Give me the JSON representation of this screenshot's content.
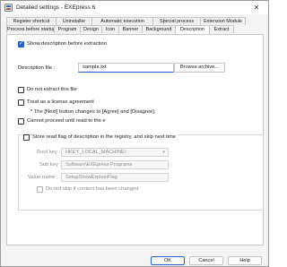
{
  "window": {
    "title": "Detailed settings - EXEpress 6",
    "close_glyph": "✕"
  },
  "tabs_row1": [
    "Register shortcut",
    "Uninstaller",
    "Automatic execution",
    "Special process",
    "Extension Module"
  ],
  "tabs_row2": [
    "Process before startup",
    "Program",
    "Design",
    "Icon",
    "Banner",
    "Background",
    "Description",
    "Extract"
  ],
  "active_tab": "Description",
  "description": {
    "show_before_extraction": {
      "label": "Show description before extraction",
      "checked": true
    },
    "file_label": "Description file :",
    "file_value": "sample.txt",
    "browse_label": "Browse archive...",
    "do_not_extract": {
      "label": "Do not extract this file",
      "checked": false
    },
    "license": {
      "label": "Treat as a license agreement",
      "checked": false
    },
    "license_note": "* The [Next] button changes to [Agree] and [Disagree].",
    "cannot_proceed": {
      "label": "Cannot proceed until read to the e",
      "checked": false
    },
    "store_flag": {
      "label": "Store read flag of description in the registry, and skip next time",
      "checked": false
    },
    "root_key_label": "Root key :",
    "root_key_value": "HKEY_LOCAL_MACHINE\\",
    "sub_key_label": "Sub key :",
    "sub_key_value": "Software\\EXEpress Programs",
    "value_name_label": "Value name :",
    "value_name_value": "SetupShowExplainFlag",
    "do_not_skip": {
      "label": "Do not skip if content has been changed",
      "checked": false
    }
  },
  "footer": {
    "ok": "OK",
    "cancel": "Cancel",
    "help": "Help"
  },
  "colors": {
    "accent": "#2563c9",
    "tab_border": "#c8c8c8"
  },
  "icons": {
    "app": "exepress-app-icon",
    "close": "close-icon",
    "combo": "chevron-down-icon"
  }
}
